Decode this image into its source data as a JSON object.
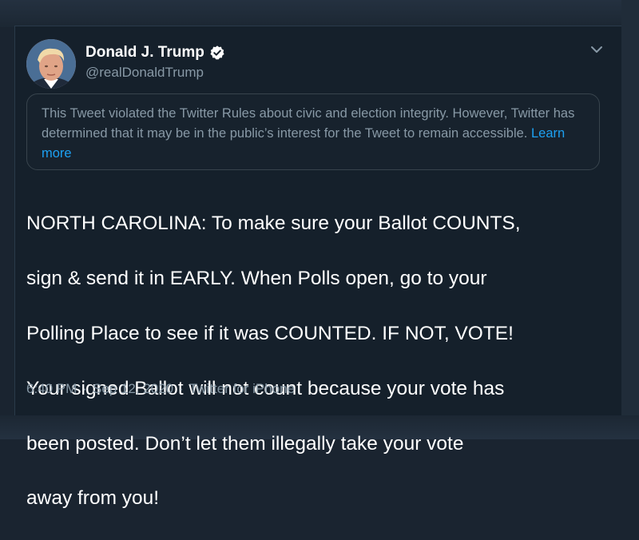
{
  "tweet": {
    "author": {
      "display_name": "Donald J. Trump",
      "handle": "@realDonaldTrump",
      "verified": true,
      "avatar_icon": "profile-photo"
    },
    "notice": {
      "text": "This Tweet violated the Twitter Rules about civic and election integrity. However, Twitter has determined that it may be in the public’s interest for the Tweet to remain accessible.",
      "link_label": "Learn more"
    },
    "text_lines": [
      "NORTH CAROLINA: To make sure your Ballot COUNTS,",
      "sign & send it in EARLY. When Polls open, go to your",
      "Polling Place to see if it was COUNTED. IF NOT, VOTE!",
      "Your signed Ballot will not count because your vote has",
      "been posted. Don’t let them illegally take your vote",
      "away from you!"
    ],
    "time": "6:40 PM",
    "date": "Sep 12, 2020",
    "separator": "·",
    "source": "Twitter for iPhone",
    "menu_icon": "chevron-down-icon"
  },
  "colors": {
    "background": "#15202b",
    "text_primary": "#ffffff",
    "text_secondary": "#8899a6",
    "link": "#1da1f2",
    "verified_badge": "#ffffff"
  }
}
